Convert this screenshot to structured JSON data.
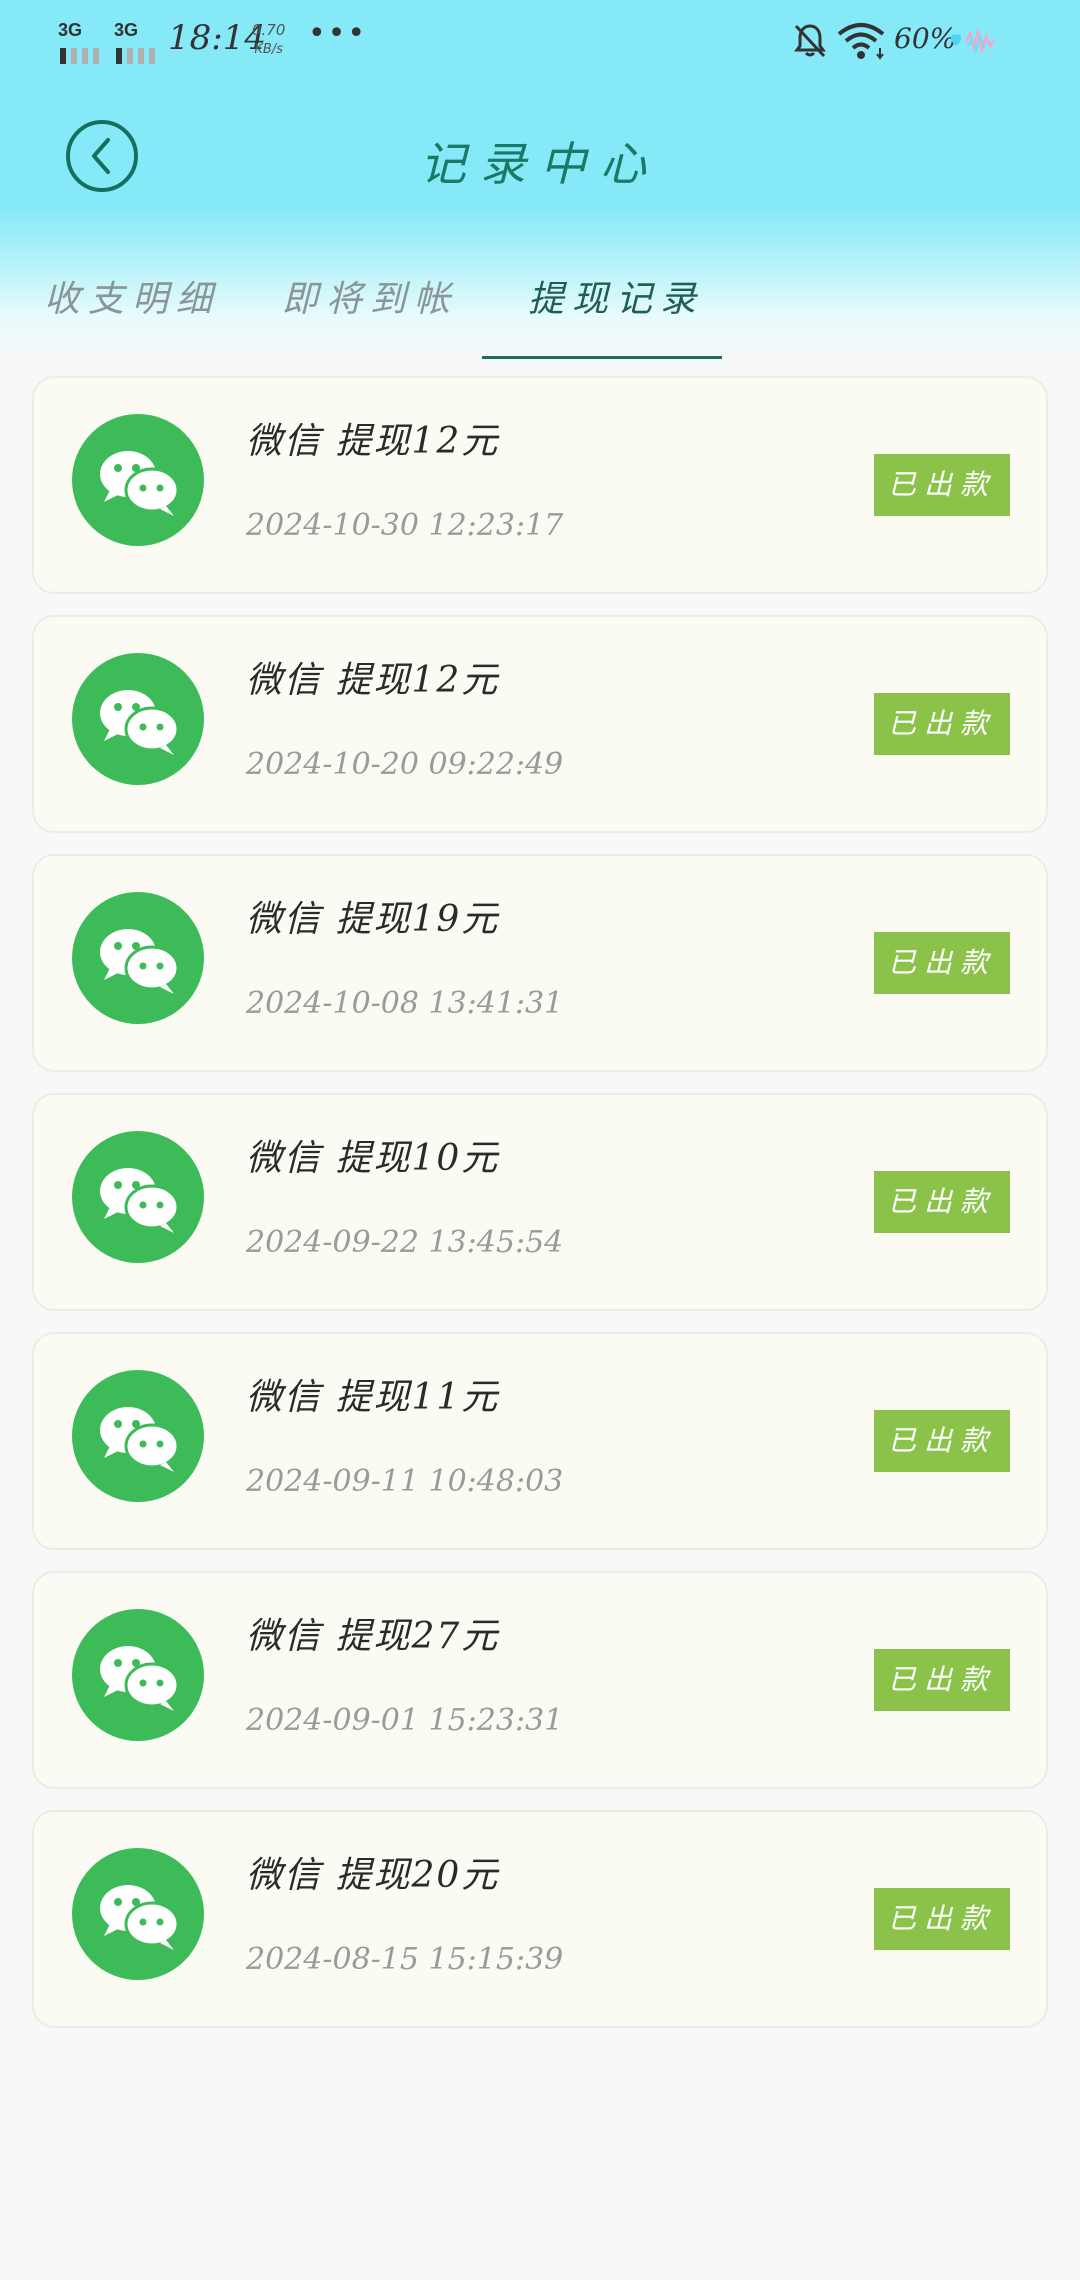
{
  "status_bar": {
    "sim1": "3G",
    "sim2": "3G",
    "time": "18:14",
    "net_speed_value": "0.70",
    "net_speed_unit": "KB/s",
    "battery": "60%"
  },
  "header": {
    "title": "记录中心"
  },
  "tabs": [
    {
      "label": "收支明细",
      "active": false
    },
    {
      "label": "即将到帐",
      "active": false
    },
    {
      "label": "提现记录",
      "active": true
    }
  ],
  "records": [
    {
      "title": "微信 提现12元",
      "time": "2024-10-30 12:23:17",
      "status": "已出款"
    },
    {
      "title": "微信 提现12元",
      "time": "2024-10-20 09:22:49",
      "status": "已出款"
    },
    {
      "title": "微信 提现19元",
      "time": "2024-10-08 13:41:31",
      "status": "已出款"
    },
    {
      "title": "微信 提现10元",
      "time": "2024-09-22 13:45:54",
      "status": "已出款"
    },
    {
      "title": "微信 提现11元",
      "time": "2024-09-11 10:48:03",
      "status": "已出款"
    },
    {
      "title": "微信 提现27元",
      "time": "2024-09-01 15:23:31",
      "status": "已出款"
    },
    {
      "title": "微信 提现20元",
      "time": "2024-08-15 15:15:39",
      "status": "已出款"
    }
  ],
  "colors": {
    "header_bg": "#86e9f8",
    "accent": "#1b6f60",
    "wechat_green": "#3cbb58",
    "badge_green": "#8bc34a"
  },
  "icons": {
    "back": "back-arrow-icon",
    "record": "wechat-icon"
  }
}
